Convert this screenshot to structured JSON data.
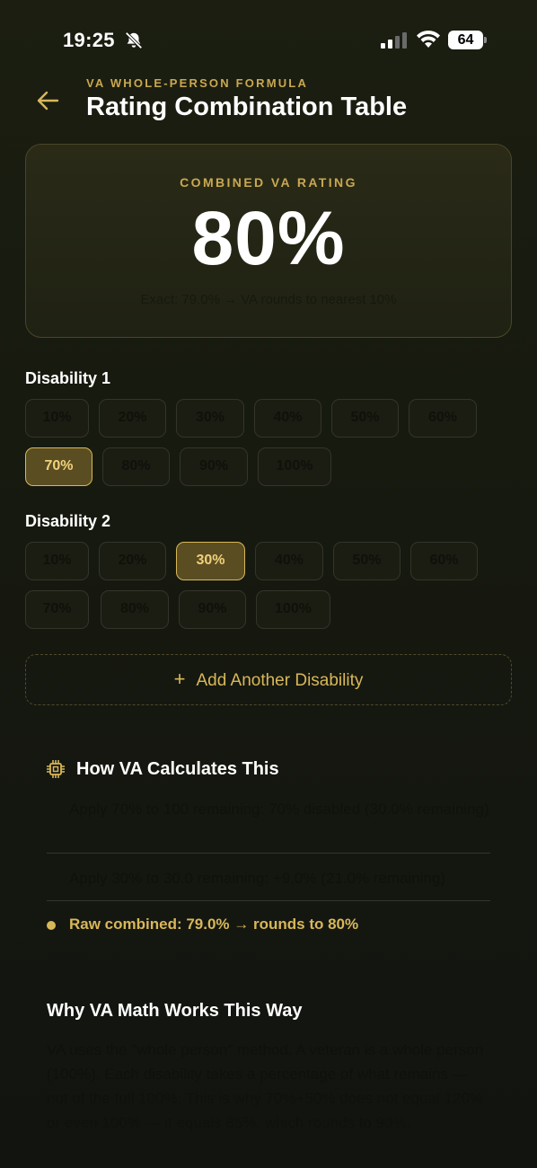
{
  "status": {
    "time": "19:25",
    "battery": "64"
  },
  "header": {
    "eyebrow": "VA WHOLE-PERSON FORMULA",
    "title": "Rating Combination Table"
  },
  "result": {
    "label": "COMBINED VA RATING",
    "value": "80%",
    "note": "Exact: 79.0% → VA rounds to nearest 10%"
  },
  "disability1": {
    "label": "Disability 1",
    "options": [
      "10%",
      "20%",
      "30%",
      "40%",
      "50%",
      "60%",
      "70%",
      "80%",
      "90%",
      "100%"
    ],
    "selected": "70%"
  },
  "disability2": {
    "label": "Disability 2",
    "options": [
      "10%",
      "20%",
      "30%",
      "40%",
      "50%",
      "60%",
      "70%",
      "80%",
      "90%",
      "100%"
    ],
    "selected": "30%"
  },
  "add_button": {
    "plus": "+",
    "label": "Add Another Disability"
  },
  "how": {
    "title": "How VA Calculates This",
    "steps": [
      "Apply 70% to 100 remaining: 70% disabled (30.0% remaining)",
      "Apply 30% to 30.0 remaining: +9.0% (21.0% remaining)"
    ],
    "raw": "Raw combined: 79.0% → rounds to 80%"
  },
  "why": {
    "title": "Why VA Math Works This Way",
    "body": "VA uses the \"whole person\" method. A veteran is a whole person (100%). Each disability takes a percentage of what remains — not of the full 100%. This is why 70%+50% does not equal 120% or even 100% — it equals 85%, which rounds to 90%."
  },
  "colors": {
    "accent": "#d8b759",
    "background": "#161810",
    "selected_chip": "#5a4d22"
  }
}
